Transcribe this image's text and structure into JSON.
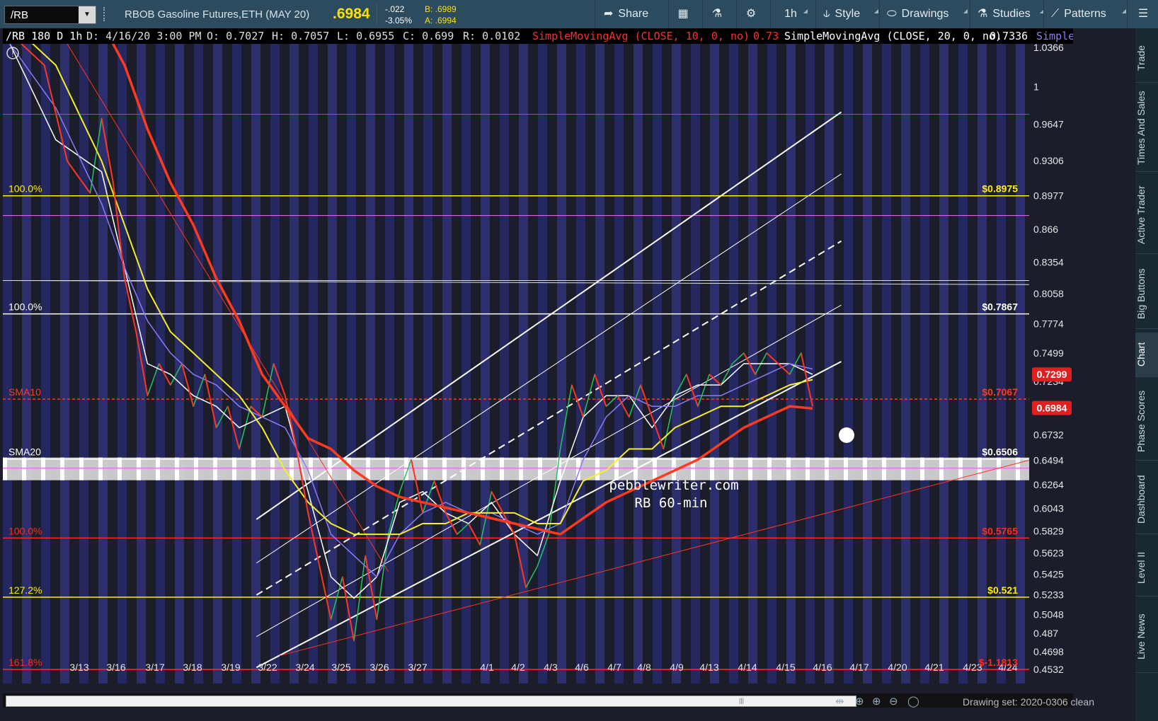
{
  "toolbar": {
    "symbol": "/RB",
    "description": "RBOB Gasoline Futures,ETH (MAY 20)",
    "last": ".6984",
    "change": "-.022",
    "change_pct": "-3.05%",
    "bid": "B: .6989",
    "ask": "A: .6994",
    "share": "Share",
    "timeframe": "1h",
    "style": "Style",
    "drawings": "Drawings",
    "studies": "Studies",
    "patterns": "Patterns"
  },
  "infobar": {
    "header": "/RB 180 D 1h",
    "date": "D: 4/16/20 3:00 PM",
    "open": "O: 0.7027",
    "high": "H: 0.7057",
    "low": "L: 0.6955",
    "close": "C: 0.699",
    "range": "R: 0.0102",
    "sma10": "SimpleMovingAvg (CLOSE, 10, 0, no)",
    "sma10_val": "0.73",
    "sma20": "SimpleMovingAvg (CLOSE, 20, 0, no)",
    "sma20_val": "0.7336",
    "sma50": "SimpleMovingAvg (CLOSE,..."
  },
  "right_tabs": [
    "Trade",
    "Times And Sales",
    "Active Trader",
    "Big Buttons",
    "Chart",
    "Phase Scores",
    "Dashboard",
    "Level II",
    "Live News"
  ],
  "status": {
    "drawing_set": "Drawing set: 2020-0306 clean"
  },
  "chart_data": {
    "type": "line",
    "ylim": [
      0.44,
      1.04
    ],
    "y_ticks": [
      "1.0366",
      "1",
      "0.9647",
      "0.9306",
      "0.8977",
      "0.866",
      "0.8354",
      "0.8058",
      "0.7774",
      "0.7499",
      "0.7234",
      "0.6977",
      "0.6732",
      "0.6494",
      "0.6264",
      "0.6043",
      "0.5829",
      "0.5623",
      "0.5425",
      "0.5233",
      "0.5048",
      "0.487",
      "0.4698",
      "0.4532"
    ],
    "x_ticks": [
      "3/13",
      "3/16",
      "3/17",
      "3/18",
      "3/19",
      "3/22",
      "3/24",
      "3/25",
      "3/26",
      "3/27",
      "4/1",
      "4/2",
      "4/3",
      "4/6",
      "4/7",
      "4/8",
      "4/9",
      "4/13",
      "4/14",
      "4/15",
      "4/16",
      "4/17",
      "4/20",
      "4/21",
      "4/23",
      "4/24"
    ],
    "price_labels": [
      {
        "text": "0.7299",
        "value": 0.7299,
        "color": "#e02020"
      },
      {
        "text": "0.6984",
        "value": 0.6984,
        "color": "#e02020"
      }
    ],
    "levels": [
      {
        "left": "100.0%",
        "right": "$0.8975",
        "value": 0.8975,
        "color": "#fff000"
      },
      {
        "left": "100.0%",
        "right": "$0.7867",
        "value": 0.7867,
        "color": "#ffffff"
      },
      {
        "left": "SMA10",
        "right": "$0.7067",
        "value": 0.7067,
        "color": "#ff3b1f"
      },
      {
        "left": "SMA20",
        "right": "$0.6506",
        "value": 0.6506,
        "color": "#ffffff"
      },
      {
        "left": "100.0%",
        "right": "$0.5765",
        "value": 0.5765,
        "color": "#ff2a1a"
      },
      {
        "left": "127.2%",
        "right": "$0.521",
        "value": 0.521,
        "color": "#fff000"
      },
      {
        "left": "161.8%",
        "right": "$-1.1813",
        "value": 0.4532,
        "color": "#ff2a1a"
      }
    ],
    "watermark": [
      "pebblewriter.com",
      "RB  60-min"
    ],
    "series": [
      {
        "name": "Price",
        "color": "#22c55e",
        "values": [
          [
            0,
            1.05
          ],
          [
            3,
            1.02
          ],
          [
            5,
            0.93
          ],
          [
            7,
            0.9
          ],
          [
            8,
            0.97
          ],
          [
            9,
            0.91
          ],
          [
            10,
            0.82
          ],
          [
            11,
            0.77
          ],
          [
            12,
            0.71
          ],
          [
            13,
            0.74
          ],
          [
            14,
            0.72
          ],
          [
            15,
            0.74
          ],
          [
            16,
            0.7
          ],
          [
            17,
            0.73
          ],
          [
            18,
            0.68
          ],
          [
            19,
            0.7
          ],
          [
            20,
            0.66
          ],
          [
            21,
            0.7
          ],
          [
            22,
            0.69
          ],
          [
            23,
            0.74
          ],
          [
            24,
            0.71
          ],
          [
            25,
            0.66
          ],
          [
            26,
            0.6
          ],
          [
            27,
            0.55
          ],
          [
            28,
            0.5
          ],
          [
            29,
            0.54
          ],
          [
            30,
            0.48
          ],
          [
            31,
            0.56
          ],
          [
            32,
            0.5
          ],
          [
            33,
            0.58
          ],
          [
            34,
            0.62
          ],
          [
            35,
            0.65
          ],
          [
            36,
            0.6
          ],
          [
            37,
            0.63
          ],
          [
            38,
            0.6
          ],
          [
            39,
            0.58
          ],
          [
            40,
            0.59
          ],
          [
            41,
            0.57
          ],
          [
            42,
            0.62
          ],
          [
            43,
            0.6
          ],
          [
            44,
            0.58
          ],
          [
            45,
            0.53
          ],
          [
            46,
            0.55
          ],
          [
            47,
            0.58
          ],
          [
            48,
            0.66
          ],
          [
            49,
            0.72
          ],
          [
            50,
            0.69
          ],
          [
            51,
            0.73
          ],
          [
            52,
            0.7
          ],
          [
            53,
            0.71
          ],
          [
            54,
            0.69
          ],
          [
            55,
            0.72
          ],
          [
            56,
            0.69
          ],
          [
            57,
            0.66
          ],
          [
            58,
            0.71
          ],
          [
            59,
            0.73
          ],
          [
            60,
            0.7
          ],
          [
            61,
            0.73
          ],
          [
            62,
            0.72
          ],
          [
            63,
            0.74
          ],
          [
            64,
            0.75
          ],
          [
            65,
            0.73
          ],
          [
            66,
            0.75
          ],
          [
            67,
            0.74
          ],
          [
            68,
            0.73
          ],
          [
            69,
            0.75
          ],
          [
            70,
            0.7
          ]
        ]
      },
      {
        "name": "SMA10",
        "color": "#ffffff",
        "values": [
          [
            0,
            1.04
          ],
          [
            4,
            0.95
          ],
          [
            8,
            0.92
          ],
          [
            10,
            0.83
          ],
          [
            12,
            0.74
          ],
          [
            14,
            0.73
          ],
          [
            16,
            0.71
          ],
          [
            18,
            0.7
          ],
          [
            20,
            0.68
          ],
          [
            22,
            0.69
          ],
          [
            24,
            0.7
          ],
          [
            26,
            0.62
          ],
          [
            28,
            0.54
          ],
          [
            30,
            0.52
          ],
          [
            32,
            0.54
          ],
          [
            34,
            0.61
          ],
          [
            36,
            0.62
          ],
          [
            38,
            0.6
          ],
          [
            40,
            0.59
          ],
          [
            42,
            0.61
          ],
          [
            44,
            0.58
          ],
          [
            46,
            0.56
          ],
          [
            48,
            0.63
          ],
          [
            50,
            0.69
          ],
          [
            52,
            0.71
          ],
          [
            54,
            0.71
          ],
          [
            56,
            0.68
          ],
          [
            58,
            0.71
          ],
          [
            60,
            0.72
          ],
          [
            62,
            0.72
          ],
          [
            64,
            0.74
          ],
          [
            66,
            0.74
          ],
          [
            68,
            0.74
          ],
          [
            70,
            0.73
          ]
        ]
      },
      {
        "name": "SMA50",
        "color": "#8a7cf7",
        "values": [
          [
            0,
            1.04
          ],
          [
            4,
            0.98
          ],
          [
            8,
            0.89
          ],
          [
            10,
            0.83
          ],
          [
            12,
            0.78
          ],
          [
            14,
            0.75
          ],
          [
            16,
            0.73
          ],
          [
            18,
            0.72
          ],
          [
            20,
            0.7
          ],
          [
            22,
            0.69
          ],
          [
            24,
            0.68
          ],
          [
            26,
            0.64
          ],
          [
            28,
            0.58
          ],
          [
            30,
            0.56
          ],
          [
            32,
            0.54
          ],
          [
            34,
            0.58
          ],
          [
            36,
            0.6
          ],
          [
            38,
            0.61
          ],
          [
            40,
            0.6
          ],
          [
            42,
            0.6
          ],
          [
            44,
            0.59
          ],
          [
            46,
            0.58
          ],
          [
            48,
            0.59
          ],
          [
            50,
            0.65
          ],
          [
            52,
            0.69
          ],
          [
            54,
            0.71
          ],
          [
            56,
            0.7
          ],
          [
            58,
            0.7
          ],
          [
            60,
            0.71
          ],
          [
            62,
            0.71
          ],
          [
            64,
            0.72
          ],
          [
            66,
            0.73
          ],
          [
            68,
            0.74
          ],
          [
            70,
            0.735
          ]
        ]
      },
      {
        "name": "SMA100",
        "color": "#f5ef2a",
        "values": [
          [
            0,
            1.06
          ],
          [
            4,
            1.02
          ],
          [
            8,
            0.93
          ],
          [
            10,
            0.87
          ],
          [
            12,
            0.81
          ],
          [
            14,
            0.77
          ],
          [
            16,
            0.75
          ],
          [
            18,
            0.73
          ],
          [
            20,
            0.71
          ],
          [
            22,
            0.68
          ],
          [
            24,
            0.64
          ],
          [
            26,
            0.61
          ],
          [
            28,
            0.59
          ],
          [
            30,
            0.58
          ],
          [
            32,
            0.58
          ],
          [
            34,
            0.58
          ],
          [
            36,
            0.59
          ],
          [
            38,
            0.59
          ],
          [
            40,
            0.6
          ],
          [
            42,
            0.6
          ],
          [
            44,
            0.6
          ],
          [
            46,
            0.59
          ],
          [
            48,
            0.59
          ],
          [
            50,
            0.63
          ],
          [
            52,
            0.64
          ],
          [
            54,
            0.66
          ],
          [
            56,
            0.66
          ],
          [
            58,
            0.68
          ],
          [
            60,
            0.69
          ],
          [
            62,
            0.7
          ],
          [
            64,
            0.7
          ],
          [
            66,
            0.71
          ],
          [
            68,
            0.72
          ],
          [
            70,
            0.725
          ]
        ]
      },
      {
        "name": "SMA200",
        "color": "#ff3b1f",
        "values": [
          [
            8,
            1.06
          ],
          [
            10,
            1.02
          ],
          [
            12,
            0.96
          ],
          [
            14,
            0.91
          ],
          [
            16,
            0.87
          ],
          [
            18,
            0.82
          ],
          [
            20,
            0.78
          ],
          [
            22,
            0.73
          ],
          [
            24,
            0.7
          ],
          [
            26,
            0.67
          ],
          [
            28,
            0.66
          ],
          [
            30,
            0.64
          ],
          [
            32,
            0.625
          ],
          [
            34,
            0.615
          ],
          [
            36,
            0.61
          ],
          [
            38,
            0.605
          ],
          [
            40,
            0.6
          ],
          [
            42,
            0.595
          ],
          [
            44,
            0.59
          ],
          [
            46,
            0.585
          ],
          [
            48,
            0.58
          ],
          [
            50,
            0.595
          ],
          [
            52,
            0.61
          ],
          [
            54,
            0.62
          ],
          [
            56,
            0.63
          ],
          [
            58,
            0.64
          ],
          [
            60,
            0.65
          ],
          [
            62,
            0.665
          ],
          [
            64,
            0.68
          ],
          [
            66,
            0.69
          ],
          [
            68,
            0.7
          ],
          [
            70,
            0.698
          ]
        ]
      }
    ]
  }
}
